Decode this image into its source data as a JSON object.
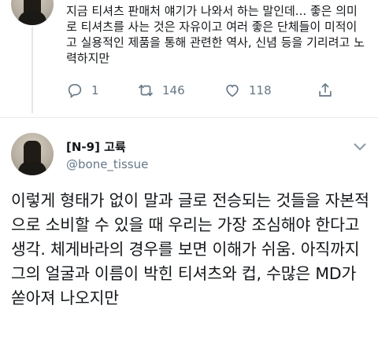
{
  "reply_tweet": {
    "text": "지금 티셔츠 판매처 얘기가 나와서 하는 말인데... 좋은 의미로 티셔츠를 사는 것은 자유이고 여러 좋은 단체들이 미적이고 실용적인 제품을 통해 관련한 역사, 신념 등을 기리려고 노력하지만",
    "reply_count": "1",
    "retweet_count": "146",
    "like_count": "118"
  },
  "main_tweet": {
    "display_name": "[N-9] 고륙",
    "handle": "@bone_tissue",
    "text": "이렇게 형태가 없이 말과 글로 전승되는 것들을 자본적으로 소비할 수 있을 때 우리는 가장 조심해야 한다고 생각. 체게바라의 경우를 보면 이해가 쉬움. 아직까지 그의 얼굴과 이름이 박힌 티셔츠와 컵, 수많은 MD가 쏟아져 나오지만"
  },
  "colors": {
    "text": "#14171a",
    "secondary": "#657786",
    "divider": "#e6ecf0"
  },
  "icons": [
    "reply-icon",
    "retweet-icon",
    "like-icon",
    "share-icon",
    "chevron-down-icon"
  ]
}
